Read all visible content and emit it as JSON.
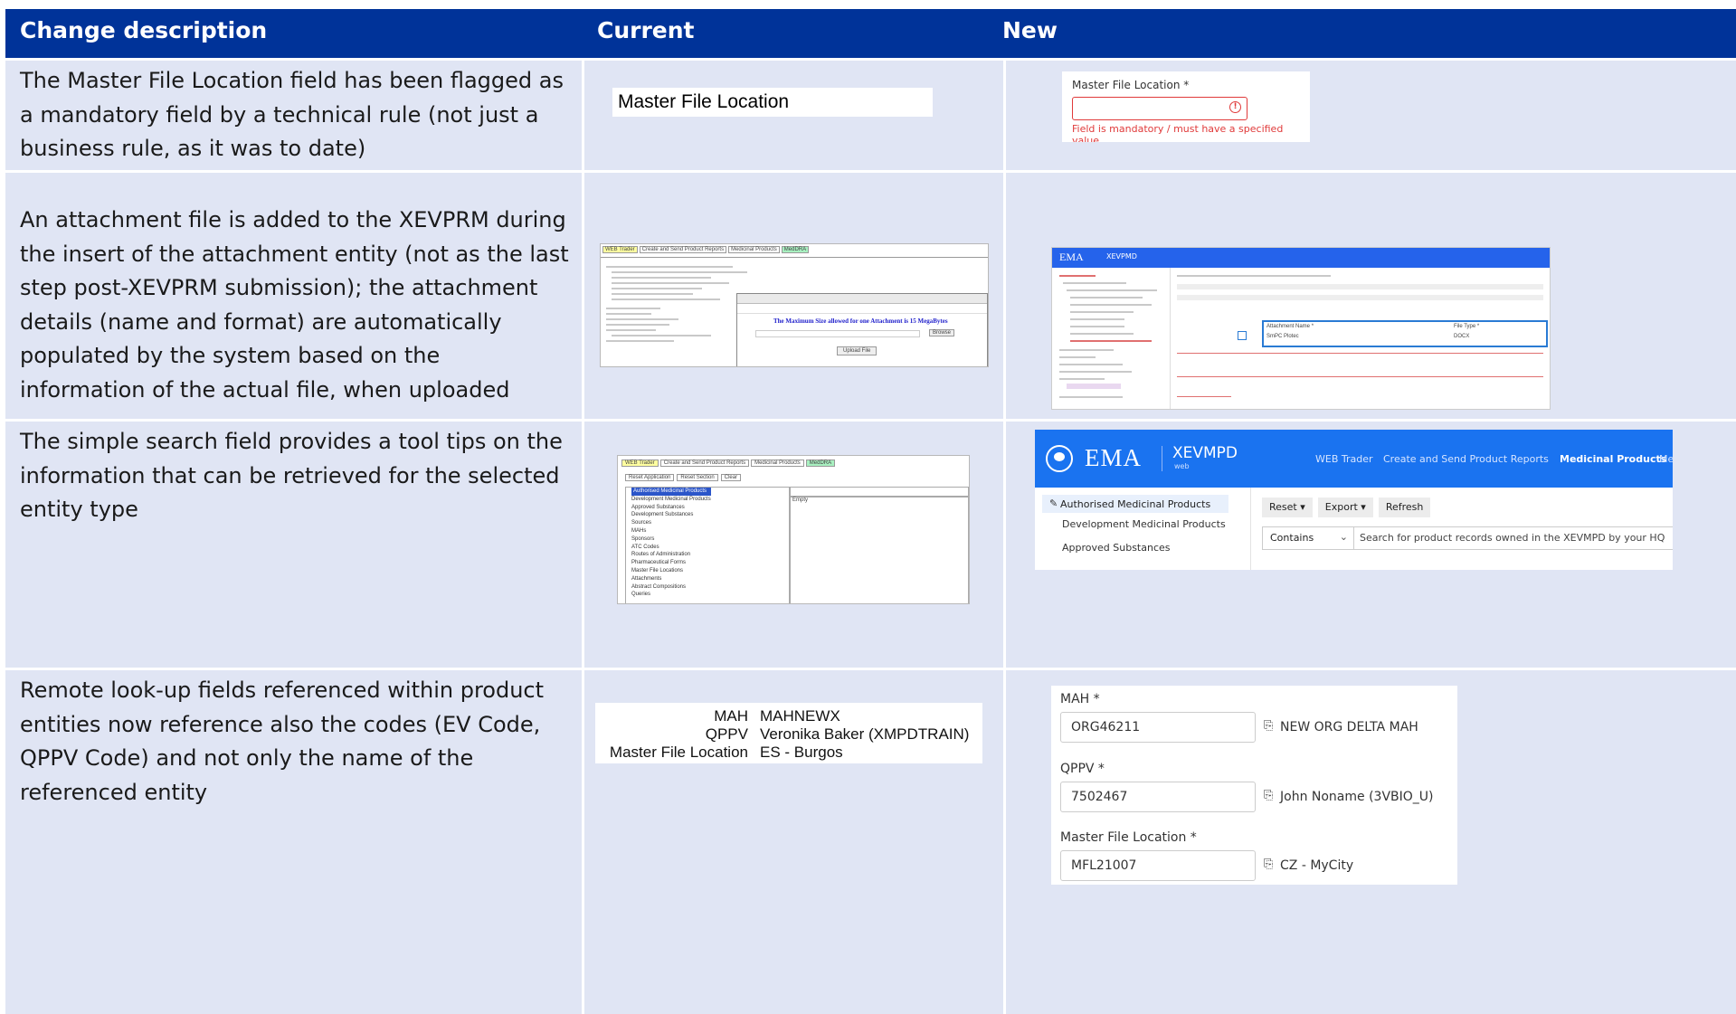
{
  "header": {
    "col1": "Change description",
    "col2": "Current",
    "col3": "New"
  },
  "rows": [
    {
      "description": "The Master File Location field has been flagged as a mandatory field by a technical rule (not just a business rule, as it was to date)",
      "current": {
        "field_label": "Master File Location"
      },
      "new": {
        "label": "Master File Location *",
        "error": "Field is mandatory / must have a specified value",
        "icon": "alert-circle-icon"
      }
    },
    {
      "description": "An attachment file is added to the XEVPRM during the insert of the attachment entity (not as the last step post-XEVPRM submission); the attachment details (name and format) are automatically populated by the system based on the information of the actual file, when uploaded",
      "current": {
        "tabs": [
          "WEB Trader",
          "Create and Send Product Reports",
          "Medicinal Products",
          "MedDRA"
        ],
        "dialog_notice": "The Maximum Size allowed for one Attachment is 15 MegaBytes",
        "upload_button": "Upload File",
        "browse_button": "Browse"
      },
      "new": {
        "logo": "EMA",
        "app": "XEVPMD",
        "attachment_name_label": "Attachment Name *",
        "attachment_name_value": "SmPC Plotec",
        "file_type_label": "File Type *",
        "file_type_value": "DOCX"
      }
    },
    {
      "description": "The simple search field provides a tool tips on the information that can be retrieved for the selected entity type",
      "current": {
        "tabs": [
          "WEB Trader",
          "Create and Send Product Reports",
          "Medicinal Products",
          "MedDRA"
        ],
        "buttons": [
          "Reset Application",
          "Reset Section",
          "Clear"
        ],
        "tree": [
          "Authorised Medicinal Products",
          "Development Medicinal Products",
          "Approved Substances",
          "Development Substances",
          "Sources",
          "MAHs",
          "Sponsors",
          "ATC Codes",
          "Routes of Administration",
          "Pharmaceutical Forms",
          "Master File Locations",
          "Attachments",
          "Abstract Compositions",
          "Queries"
        ],
        "empty": "Empty"
      },
      "new": {
        "logo": "EMA",
        "app": "XEVMPD",
        "app_sub": "web",
        "nav": [
          "WEB Trader",
          "Create and Send Product Reports",
          "Medicinal Products",
          "Me"
        ],
        "sidebar": [
          "Authorised Medicinal Products",
          "Development Medicinal Products",
          "Approved Substances"
        ],
        "buttons": [
          "Reset",
          "Export",
          "Refresh"
        ],
        "filter": "Contains",
        "search_placeholder": "Search for product records owned in the XEVMPD by your HQ"
      }
    },
    {
      "description": "Remote look-up fields referenced within product entities now reference also the codes (EV Code, QPPV Code) and not only the name of the referenced entity",
      "current": {
        "fields": [
          {
            "label": "MAH",
            "value": "MAHNEWX"
          },
          {
            "label": "QPPV",
            "value": "Veronika Baker (XMPDTRAIN)"
          },
          {
            "label": "Master File Location",
            "value": "ES - Burgos"
          }
        ]
      },
      "new": {
        "fields": [
          {
            "label": "MAH *",
            "code": "ORG46211",
            "name": "NEW ORG DELTA MAH"
          },
          {
            "label": "QPPV *",
            "code": "7502467",
            "name": "John Noname (3VBIO_U)"
          },
          {
            "label": "Master File Location *",
            "code": "MFL21007",
            "name": "CZ - MyCity"
          }
        ]
      }
    }
  ]
}
